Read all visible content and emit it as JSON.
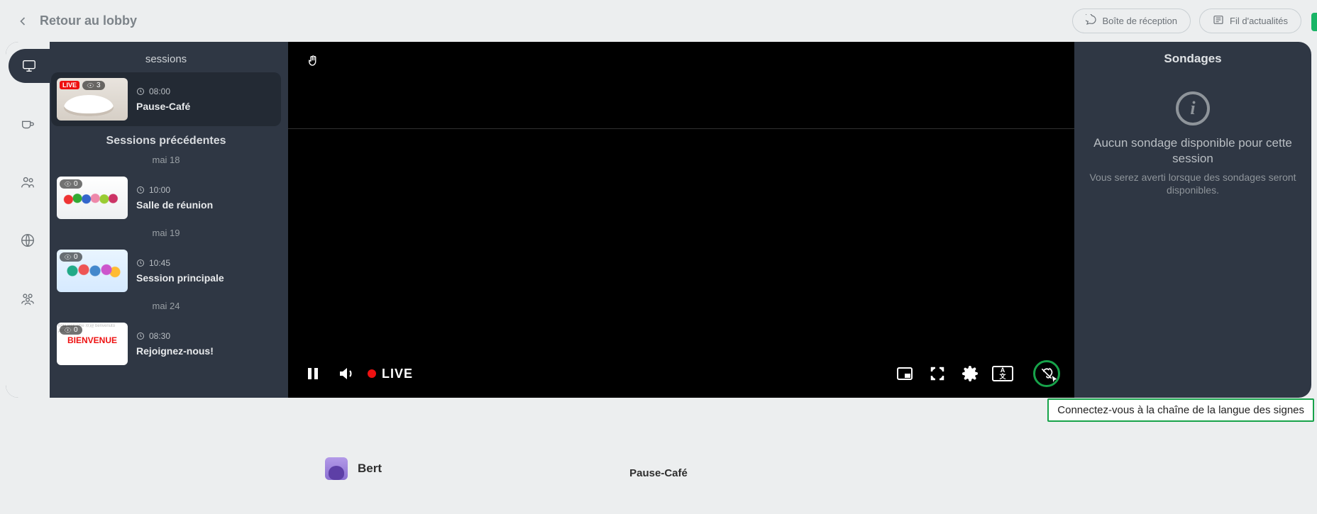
{
  "topbar": {
    "back_label": "Retour au lobby",
    "inbox_label": "Boîte de réception",
    "feed_label": "Fil d'actualités"
  },
  "sidebar": {
    "title": "sessions",
    "prev_title": "Sessions précédentes",
    "live": {
      "time": "08:00",
      "name": "Pause-Café",
      "viewers": "3"
    },
    "dates": {
      "d1": "mai 18",
      "d2": "mai 19",
      "d3": "mai 24"
    },
    "items": [
      {
        "time": "10:00",
        "name": "Salle de réunion",
        "viewers": "0"
      },
      {
        "time": "10:45",
        "name": "Session principale",
        "viewers": "0"
      },
      {
        "time": "08:30",
        "name": "Rejoignez-nous!",
        "viewers": "0"
      }
    ]
  },
  "player": {
    "live_label": "LIVE",
    "lang_text_top": "A",
    "lang_text_bot": "文"
  },
  "polls": {
    "title": "Sondages",
    "empty_title": "Aucun sondage disponible pour cette session",
    "empty_sub": "Vous serez averti lorsque des sondages seront disponibles."
  },
  "tooltip": {
    "sign_language": "Connectez-vous à la chaîne de la langue des signes"
  },
  "footer": {
    "username": "Bert",
    "room": "Pause-Café",
    "welcome_thumb": "BIENVENUE"
  }
}
